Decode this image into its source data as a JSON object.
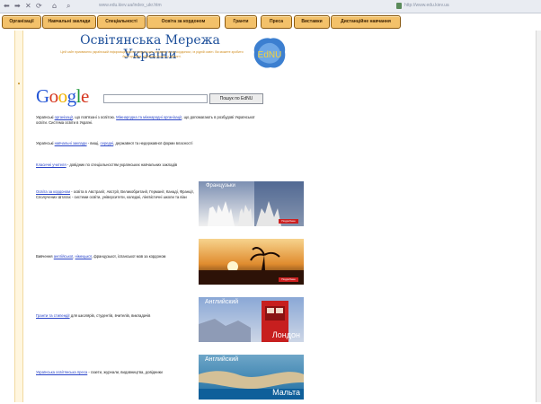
{
  "browser": {
    "url": "www.edu.kiev.ua/index_ukr.htm",
    "url_right": "http://www.edu.kiev.ua"
  },
  "nav": {
    "items": [
      "Організації",
      "Навчальні заклади",
      "Спеціальності",
      "Освіта за кордоном",
      "Гранти",
      "Преса",
      "Виставки",
      "Дистанційне навчання"
    ]
  },
  "header": {
    "title": "Освітянська Мережа України",
    "subtitle": "Цей сайт присвячено українській інформації освіти, котра може існувати, як за кордоном, і в рідній освіті. Ви можете зробити його кращим, обравши участь у проекті.",
    "logo_text": "EdNU"
  },
  "google": {
    "letters": [
      "G",
      "o",
      "o",
      "g",
      "l",
      "e"
    ],
    "colors": [
      "#2456d6",
      "#d6361f",
      "#f1b300",
      "#2456d6",
      "#1e9a3a",
      "#d6361f"
    ],
    "search_button": "Пошук по EdNU"
  },
  "content": {
    "p1": {
      "prefix": "Українські ",
      "link1": "організації",
      "mid": ", що пов'язані з освітою. ",
      "link2": "Міжнародна та міжнародні організації",
      "suffix": ", що допомагають в розбудові Української освіти. Система освіти в Україні."
    },
    "p2": {
      "prefix": "Українські ",
      "link1": "навчальні заклади",
      "mid": " - вищі, ",
      "link2": "середні",
      "suffix": ", державної та недержавної форми власності"
    },
    "p3": {
      "link": "Класичні учителя",
      "text": " - довідник по спеціальностям українських навчальних закладів"
    },
    "p4": {
      "link": "Освіта за кордоном",
      "text": " - освіта в Австралії, Австрії, Великобританії, Германії, Канаді, Франції, Сполучених Штатах - системи освіти, університети, коледжі, лінгвістичні школи та візи"
    },
    "p5": {
      "prefix": "Вивчення ",
      "link1": "англійської",
      "sep": ", ",
      "link2": "німецької",
      "suffix": ", французької, іспанської мов за кордоном"
    },
    "p6": {
      "link": "Гранти та стипендії",
      "text": " для школярів, студентів, вчителів, викладачів"
    },
    "p7": {
      "link": "Українська освітянська преса",
      "text": " - газети, журнали, видавництва, довідники"
    }
  },
  "images": {
    "img1": {
      "caption": "Французьки",
      "badge": "Подробнее"
    },
    "img2": {
      "caption": "",
      "badge": "Подробнее"
    },
    "img3": {
      "caption1": "Английский",
      "caption2": "Лондон"
    },
    "img4": {
      "caption1": "Английский",
      "caption2": "Мальта"
    }
  }
}
